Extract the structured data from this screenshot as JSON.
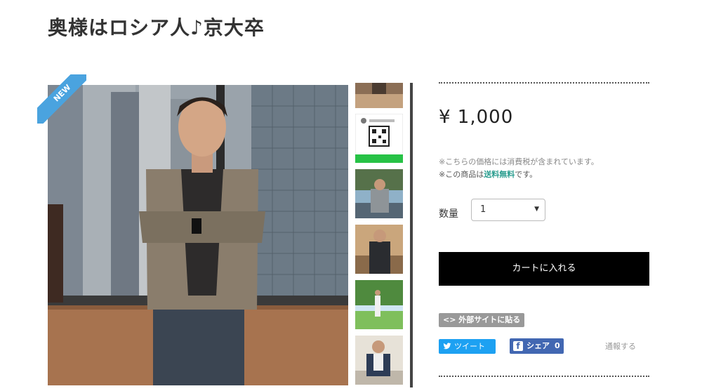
{
  "product": {
    "title": "奥様はロシア人♪京大卒",
    "badge": "NEW",
    "price": "¥ 1,000",
    "tax_note": "※こちらの価格には消費税が含まれています。",
    "shipping_note_prefix": "※この商品は",
    "shipping_note_free": "送料無料",
    "shipping_note_suffix": "です。"
  },
  "quantity": {
    "label": "数量",
    "value": "1",
    "arrow": "▼"
  },
  "actions": {
    "cart_label": "カートに入れる",
    "embed_label": "<> 外部サイトに貼る",
    "tweet_label": "ツイート",
    "share_label": "シェア",
    "share_count": "0",
    "report_label": "通報する"
  },
  "icons": {
    "twitter": "twitter-bird-icon",
    "facebook": "facebook-icon",
    "dropdown": "chevron-down-icon"
  },
  "colors": {
    "badge": "#4aa3df",
    "free_shipping": "#2a9d8f",
    "tweet": "#1da1f2",
    "facebook": "#4267b2",
    "cart": "#000000"
  }
}
